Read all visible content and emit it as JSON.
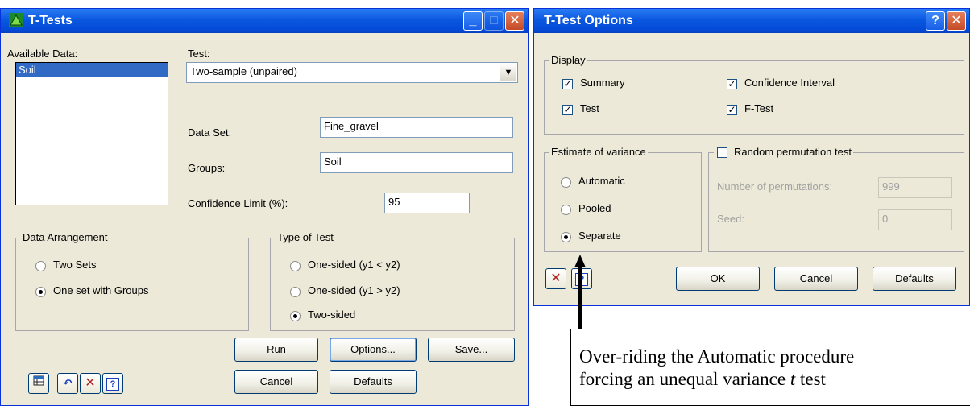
{
  "ttests": {
    "title": "T-Tests",
    "available_data_label": "Available Data:",
    "available_data_items": [
      "Soil"
    ],
    "test_label": "Test:",
    "test_value": "Two-sample (unpaired)",
    "dataset_label": "Data Set:",
    "dataset_value": "Fine_gravel",
    "groups_label": "Groups:",
    "groups_value": "Soil",
    "conf_label": "Confidence Limit (%):",
    "conf_value": "95",
    "arrangement": {
      "title": "Data Arrangement",
      "options": [
        "Two Sets",
        "One set with Groups"
      ],
      "selected": "One set with Groups"
    },
    "type_of_test": {
      "title": "Type of Test",
      "options": [
        "One-sided (y1 < y2)",
        "One-sided (y1 > y2)",
        "Two-sided"
      ],
      "selected": "Two-sided"
    },
    "buttons": {
      "run": "Run",
      "options": "Options...",
      "save": "Save...",
      "cancel": "Cancel",
      "defaults": "Defaults"
    }
  },
  "options_dialog": {
    "title": "T-Test Options",
    "display": {
      "title": "Display",
      "summary": "Summary",
      "confidence_interval": "Confidence Interval",
      "test": "Test",
      "f_test": "F-Test"
    },
    "variance": {
      "title": "Estimate of variance",
      "options": [
        "Automatic",
        "Pooled",
        "Separate"
      ],
      "selected": "Separate"
    },
    "permutation": {
      "title": "Random permutation test",
      "checked": false,
      "num_label": "Number of permutations:",
      "num_value": "999",
      "seed_label": "Seed:",
      "seed_value": "0"
    },
    "buttons": {
      "ok": "OK",
      "cancel": "Cancel",
      "defaults": "Defaults"
    }
  },
  "annotation": {
    "line1": "Over-riding the Automatic procedure",
    "line2_prefix": "forcing an unequal variance ",
    "line2_italic": "t",
    "line2_suffix": " test"
  },
  "colors": {
    "title_blue": "#0a58e0",
    "window_face": "#ece9d8",
    "close_red": "#c44a26"
  }
}
